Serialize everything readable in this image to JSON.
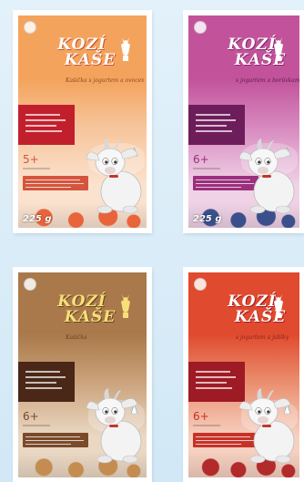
{
  "boxes": [
    {
      "id": "box-1",
      "brand_line1": "KOZÍ",
      "brand_line2": "KAŠE",
      "tagline": "Kašička s jogurtem a ovocem",
      "age": "5+",
      "weight": "225 g",
      "colors": {
        "top": "#f4a35c",
        "mid": "#f6c49a",
        "low": "#fbe2cf",
        "band": "#c21f2c",
        "logo": "#ffffff",
        "logoShade": "#c8542a",
        "tag": "#8a4a20",
        "fine": "#d4553c",
        "fruit": "#e8643a"
      }
    },
    {
      "id": "box-2",
      "brand_line1": "KOZÍ",
      "brand_line2": "KAŠE",
      "tagline": "s jogurtem a borůvkami",
      "age": "6+",
      "weight": "225 g",
      "colors": {
        "top": "#c2539b",
        "mid": "#d788be",
        "low": "#f0d2e6",
        "band": "#6e1d5b",
        "logo": "#ffffff",
        "logoShade": "#8a2668",
        "tag": "#5d1b4a",
        "fine": "#9c2f7e",
        "fruit": "#3a4f8c"
      }
    },
    {
      "id": "box-3",
      "brand_line1": "KOZÍ",
      "brand_line2": "KAŠE",
      "tagline": "Kašička",
      "age": "6+",
      "weight": "",
      "colors": {
        "top": "#a9794b",
        "mid": "#c9a078",
        "low": "#ead8c3",
        "band": "#4a2716",
        "logo": "#f6e07a",
        "logoShade": "#6a4322",
        "tag": "#6a4322",
        "fine": "#7a4a2a",
        "fruit": "#c58c52"
      }
    },
    {
      "id": "box-4",
      "brand_line1": "KOZÍ",
      "brand_line2": "KAŠE",
      "tagline": "s jogurtem a jablky",
      "age": "6+",
      "weight": "",
      "colors": {
        "top": "#e04a2e",
        "mid": "#ea8a6a",
        "low": "#f6d0c0",
        "band": "#9e1a24",
        "logo": "#ffffff",
        "logoShade": "#9e1a24",
        "tag": "#8a2216",
        "fine": "#c73226",
        "fruit": "#b22a2a"
      }
    }
  ]
}
